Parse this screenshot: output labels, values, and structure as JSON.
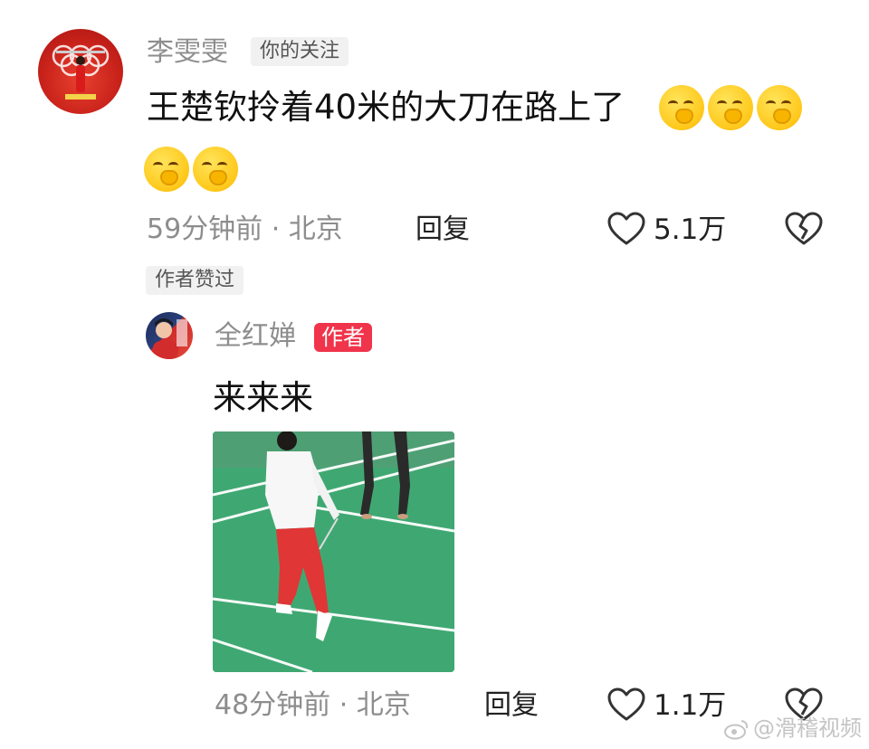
{
  "comment_main": {
    "author": "李雯雯",
    "follow_tag": "你的关注",
    "text": "王楚钦拎着40米的大刀在路上了",
    "emoji_count_line1": 3,
    "emoji_count_line2": 2,
    "emoji_icon": "hand-over-mouth-emoji",
    "time_location": "59分钟前 · 北京",
    "reply_label": "回复",
    "likes": "5.1万",
    "author_liked_tag": "作者赞过"
  },
  "comment_reply": {
    "author": "全红婵",
    "author_badge": "作者",
    "text": "来来来",
    "time_location": "48分钟前 · 北京",
    "reply_label": "回复",
    "likes": "1.1万"
  },
  "watermark": "@滑稽视频",
  "colors": {
    "author_badge_bg": "#f0344b",
    "meta_text": "#8d8d8d",
    "court_green": "#3fa872"
  }
}
